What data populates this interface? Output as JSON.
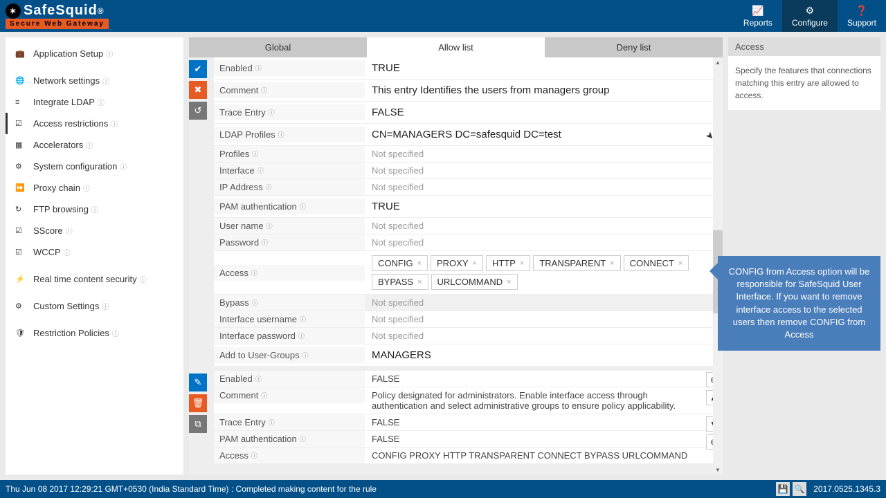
{
  "brand": {
    "name": "SafeSquid",
    "reg": "®",
    "tagline": "Secure Web Gateway"
  },
  "nav": {
    "reports": "Reports",
    "configure": "Configure",
    "support": "Support"
  },
  "sidebar": {
    "items": [
      {
        "label": "Application Setup",
        "icon": "💼"
      },
      {
        "label": "Network settings",
        "icon": "🌐"
      },
      {
        "label": "Integrate LDAP",
        "icon": "≡"
      },
      {
        "label": "Access restrictions",
        "icon": "☑"
      },
      {
        "label": "Accelerators",
        "icon": "▦"
      },
      {
        "label": "System configuration",
        "icon": "⚙"
      },
      {
        "label": "Proxy chain",
        "icon": "⏩"
      },
      {
        "label": "FTP browsing",
        "icon": "↻"
      },
      {
        "label": "SScore",
        "icon": "☑"
      },
      {
        "label": "WCCP",
        "icon": "☑"
      },
      {
        "label": "Real time content security",
        "icon": "⚡"
      },
      {
        "label": "Custom Settings",
        "icon": "⚙"
      },
      {
        "label": "Restriction Policies",
        "icon": "🛡"
      }
    ]
  },
  "tabs": {
    "global": "Global",
    "allow": "Allow list",
    "deny": "Deny list"
  },
  "entry1": {
    "labels": {
      "enabled": "Enabled",
      "comment": "Comment",
      "trace": "Trace Entry",
      "ldap": "LDAP Profiles",
      "profiles": "Profiles",
      "interface": "Interface",
      "ip": "IP Address",
      "pam": "PAM authentication",
      "user": "User name",
      "password": "Password",
      "access": "Access",
      "bypass": "Bypass",
      "iuser": "Interface username",
      "ipass": "Interface password",
      "groups": "Add to User-Groups"
    },
    "values": {
      "enabled": "TRUE",
      "comment": "This entry Identifies the users from managers group",
      "trace": "FALSE",
      "ldap": "CN=MANAGERS DC=safesquid DC=test",
      "not_specified": "Not specified",
      "pam": "TRUE",
      "groups": "MANAGERS"
    },
    "access_tags": [
      "CONFIG",
      "PROXY",
      "HTTP",
      "TRANSPARENT",
      "CONNECT",
      "BYPASS",
      "URLCOMMAND"
    ]
  },
  "entry2": {
    "values": {
      "enabled": "FALSE",
      "comment": "Policy designated for administrators. Enable interface access through authentication and select administrative groups to ensure policy applicability.",
      "trace": "FALSE",
      "pam": "FALSE",
      "access": "CONFIG  PROXY  HTTP  TRANSPARENT  CONNECT  BYPASS  URLCOMMAND"
    }
  },
  "right": {
    "title": "Access",
    "body": "Specify the features that connections matching this entry are allowed to access."
  },
  "callout": "CONFIG from Access option will be responsible for SafeSquid User Interface. If you want to remove interface access to the selected users then remove CONFIG from Access",
  "footer": {
    "status": "Thu Jun 08 2017 12:29:21 GMT+0530 (India Standard Time) : Completed making content for the rule",
    "version": "2017.0525.1345.3"
  }
}
